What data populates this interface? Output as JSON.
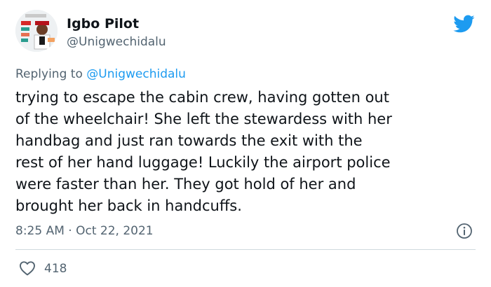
{
  "user": {
    "display_name": "Igbo Pilot",
    "handle": "@Unigwechidalu"
  },
  "reply": {
    "prefix": "Replying to ",
    "mention": "@Unigwechidalu"
  },
  "tweet": {
    "lines": [
      "trying to escape the cabin crew, having gotten out",
      "of the wheelchair! She left the stewardess with her",
      "handbag and just ran towards the exit with the",
      "rest of her hand luggage! Luckily the airport police",
      "were faster than her. They got hold of her and",
      "brought her back in handcuffs."
    ],
    "timestamp": "8:25 AM · Oct 22, 2021"
  },
  "engagement": {
    "likes": "418"
  },
  "icons": {
    "brand": "twitter-bird-icon",
    "info": "info-icon",
    "like": "heart-icon"
  },
  "colors": {
    "twitter_blue": "#1d9bf0",
    "text": "#0f1419",
    "secondary": "#536471",
    "divider": "#cfd9de"
  }
}
